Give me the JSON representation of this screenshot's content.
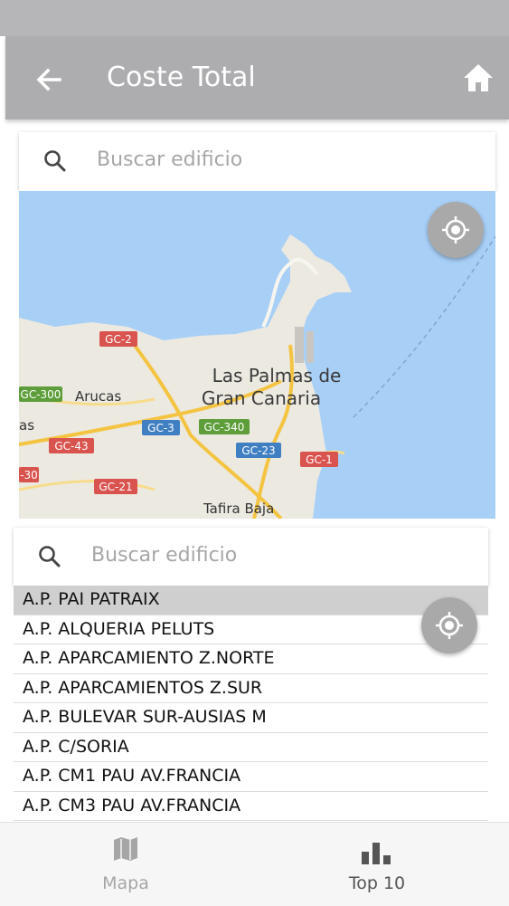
{
  "app_bar": {
    "title": "Coste Total"
  },
  "map_search": {
    "placeholder": "Buscar edificio"
  },
  "map": {
    "city_label_line1": "Las Palmas de",
    "city_label_line2": "Gran Canaria",
    "places": [
      "Arucas",
      "Tafira Baja",
      "as"
    ],
    "roads": [
      "GC-2",
      "GC-300",
      "GC-3",
      "GC-340",
      "GC-43",
      "GC-23",
      "GC-1",
      "-30",
      "GC-21"
    ]
  },
  "list_search": {
    "placeholder": "Buscar edificio"
  },
  "buildings": [
    "A.P. PAI PATRAIX",
    "A.P. ALQUERIA PELUTS",
    "A.P. APARCAMIENTO Z.NORTE",
    "A.P. APARCAMIENTOS Z.SUR",
    "A.P. BULEVAR SUR-AUSIAS M",
    "A.P. C/SORIA",
    "A.P. CM1 PAU AV.FRANCIA",
    "A.P. CM3 PAU AV.FRANCIA"
  ],
  "selected_index": 0,
  "bottom_nav": {
    "map_label": "Mapa",
    "top_label": "Top 10"
  },
  "colors": {
    "app_bar": "#adadb0",
    "selected_row": "#cfcfcf",
    "water": "#a8cff6",
    "land": "#ece9e1"
  }
}
